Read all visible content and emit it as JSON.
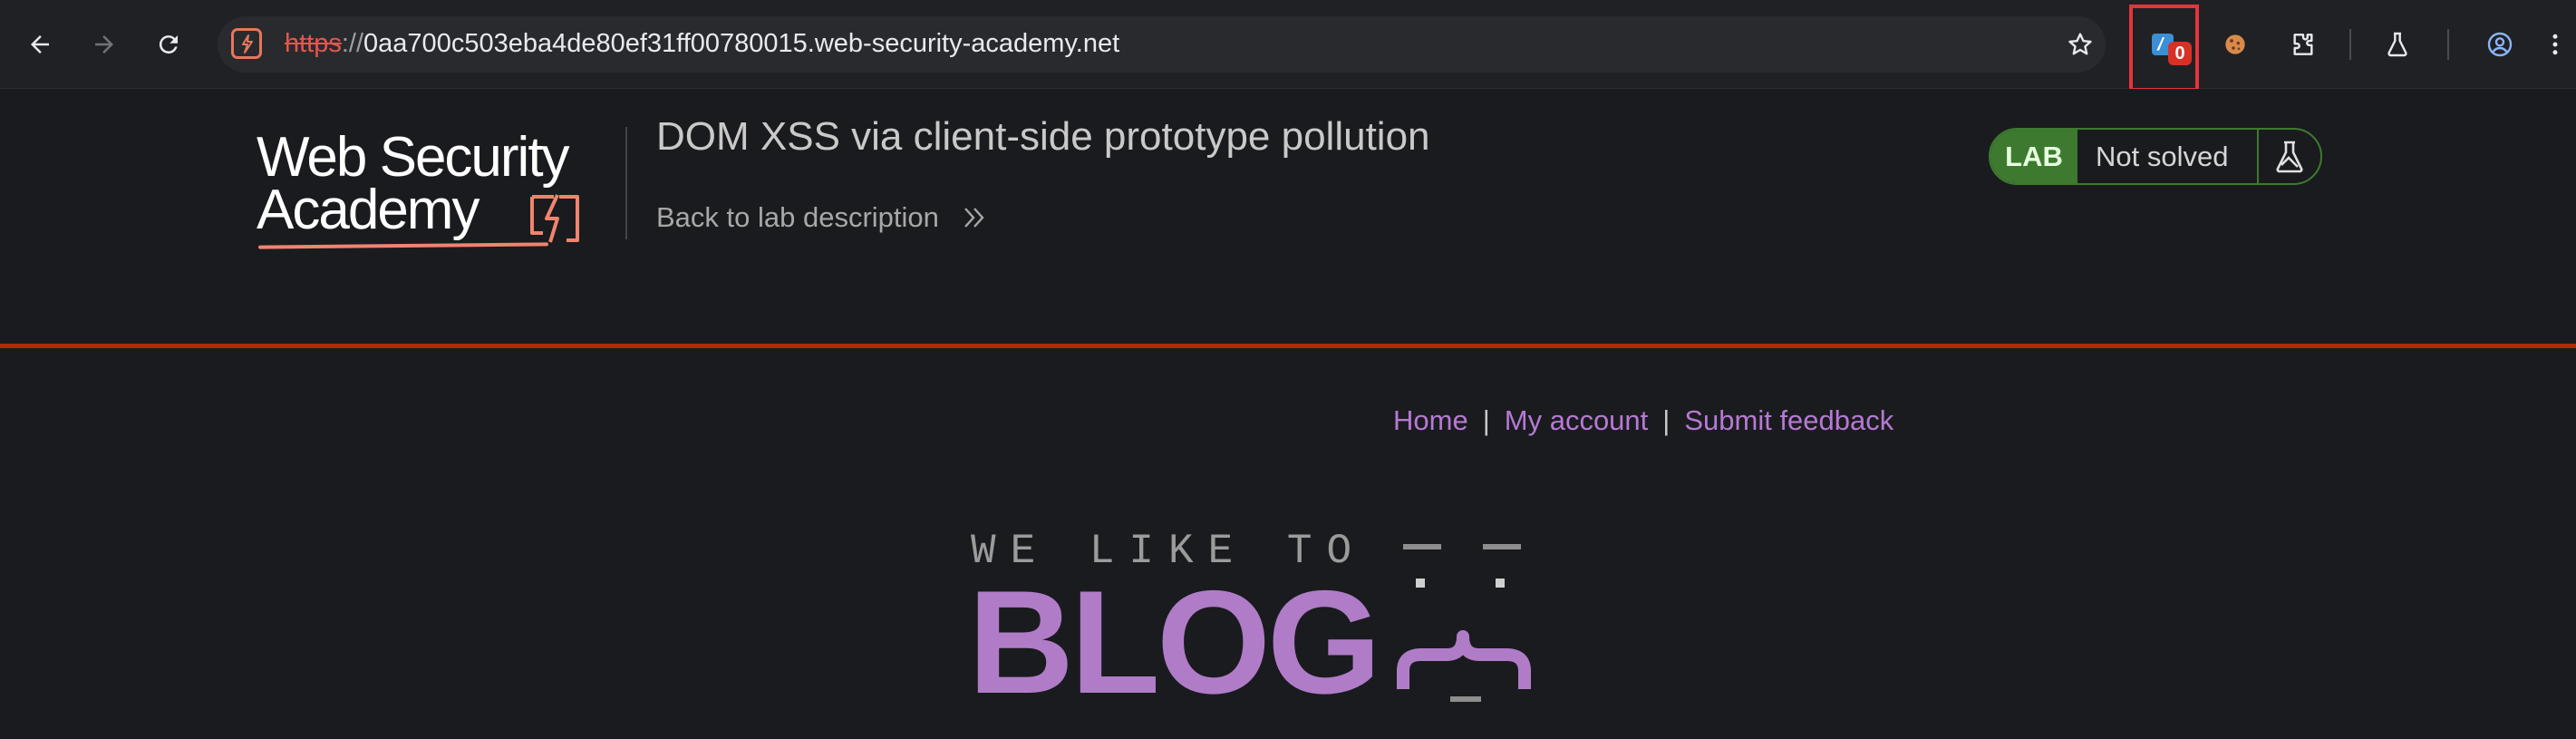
{
  "browser": {
    "url": {
      "scheme": "https",
      "separator": "://",
      "host": "0aa700c503eba4de80ef31ff00780015.web-security-academy.net"
    },
    "extension_badge": "0"
  },
  "lab_header": {
    "logo": {
      "line1": "Web Security",
      "line2": "Academy"
    },
    "title": "DOM XSS via client-side prototype pollution",
    "back_link": "Back to lab description",
    "status": {
      "label": "LAB",
      "text": "Not solved"
    }
  },
  "site_nav": {
    "items": [
      "Home",
      "My account",
      "Submit feedback"
    ],
    "separator": "|"
  },
  "banner": {
    "tagline": "WE LIKE TO",
    "title": "BLOG"
  },
  "colors": {
    "accent_orange": "#e6775d",
    "lab_green": "#3d7a2f",
    "link_purple": "#b679d4",
    "banner_purple": "#b07cc7",
    "header_rule": "#b12b0b",
    "highlight_red": "#e5343a"
  }
}
